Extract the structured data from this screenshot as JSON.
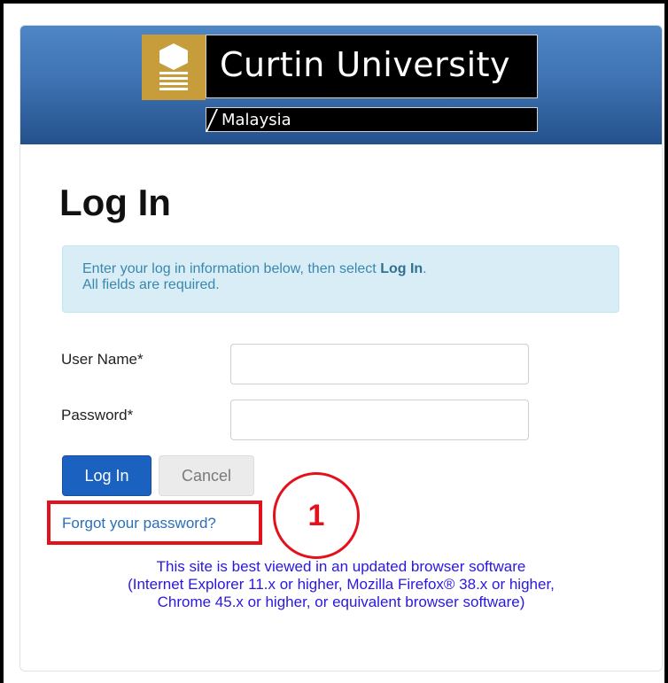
{
  "banner": {
    "logo": {
      "title": "Curtin University",
      "subtitle": "Malaysia"
    }
  },
  "form": {
    "title": "Log In",
    "info": {
      "line1_prefix": "Enter your log in information below, then select ",
      "line1_bold": "Log In",
      "line1_suffix": ".",
      "line2": "All fields are required."
    },
    "username_label": "User Name*",
    "username_value": "",
    "password_label": "Password*",
    "password_value": "",
    "login_button": "Log In",
    "cancel_button": "Cancel",
    "forgot_link": "Forgot your password?"
  },
  "annotation": {
    "callout_number": "1",
    "color": "#e4111c"
  },
  "browser_note": {
    "line1": "This site is best viewed in an updated browser software",
    "line2": "(Internet Explorer 11.x or higher, Mozilla Firefox® 38.x or higher,",
    "line3": "Chrome 45.x or higher, or equivalent browser software)"
  },
  "colors": {
    "banner": "#3f73b3",
    "logo_gold": "#c69d3a",
    "info_bg": "#d9edf7",
    "primary": "#1b62c0",
    "link": "#2a6fb7",
    "note": "#2a17e0"
  }
}
